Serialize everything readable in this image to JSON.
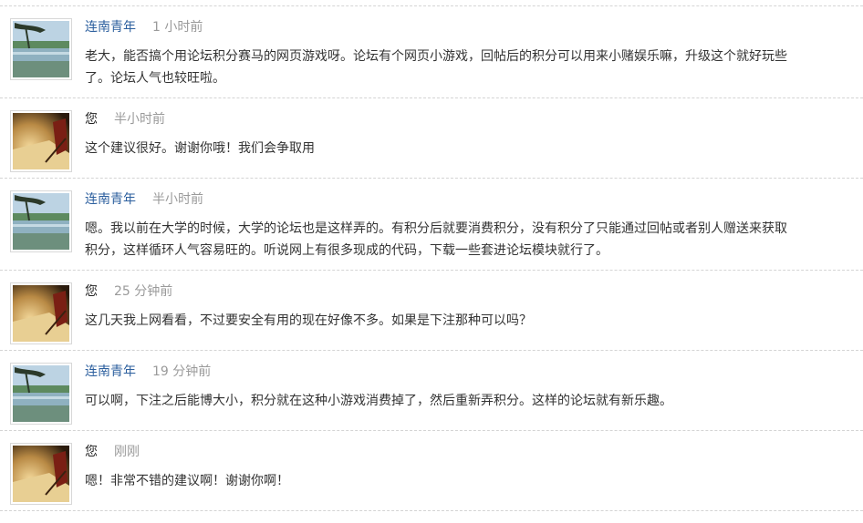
{
  "comments": [
    {
      "author": "连南青年",
      "time": "1 小时前",
      "avatar": "landscape-avatar",
      "text": "老大，能否搞个用论坛积分赛马的网页游戏呀。论坛有个网页小游戏，回帖后的积分可以用来小赌娱乐嘛，升级这个就好玩些了。论坛人气也较旺啦。"
    },
    {
      "author": "您",
      "time": "半小时前",
      "avatar": "book-pen-avatar",
      "text": "这个建议很好。谢谢你哦！我们会争取用"
    },
    {
      "author": "连南青年",
      "time": "半小时前",
      "avatar": "landscape-avatar",
      "text": "嗯。我以前在大学的时候，大学的论坛也是这样弄的。有积分后就要消费积分，没有积分了只能通过回帖或者别人赠送来获取积分，这样循环人气容易旺的。听说网上有很多现成的代码，下载一些套进论坛模块就行了。"
    },
    {
      "author": "您",
      "time": "25 分钟前",
      "avatar": "book-pen-avatar",
      "text": "这几天我上网看看，不过要安全有用的现在好像不多。如果是下注那种可以吗？"
    },
    {
      "author": "连南青年",
      "time": "19 分钟前",
      "avatar": "landscape-avatar",
      "text": "可以啊，下注之后能博大小，积分就在这种小游戏消费掉了，然后重新弄积分。这样的论坛就有新乐趣。"
    },
    {
      "author": "您",
      "time": "刚刚",
      "avatar": "book-pen-avatar",
      "text": "嗯！非常不错的建议啊！谢谢你啊！"
    }
  ]
}
